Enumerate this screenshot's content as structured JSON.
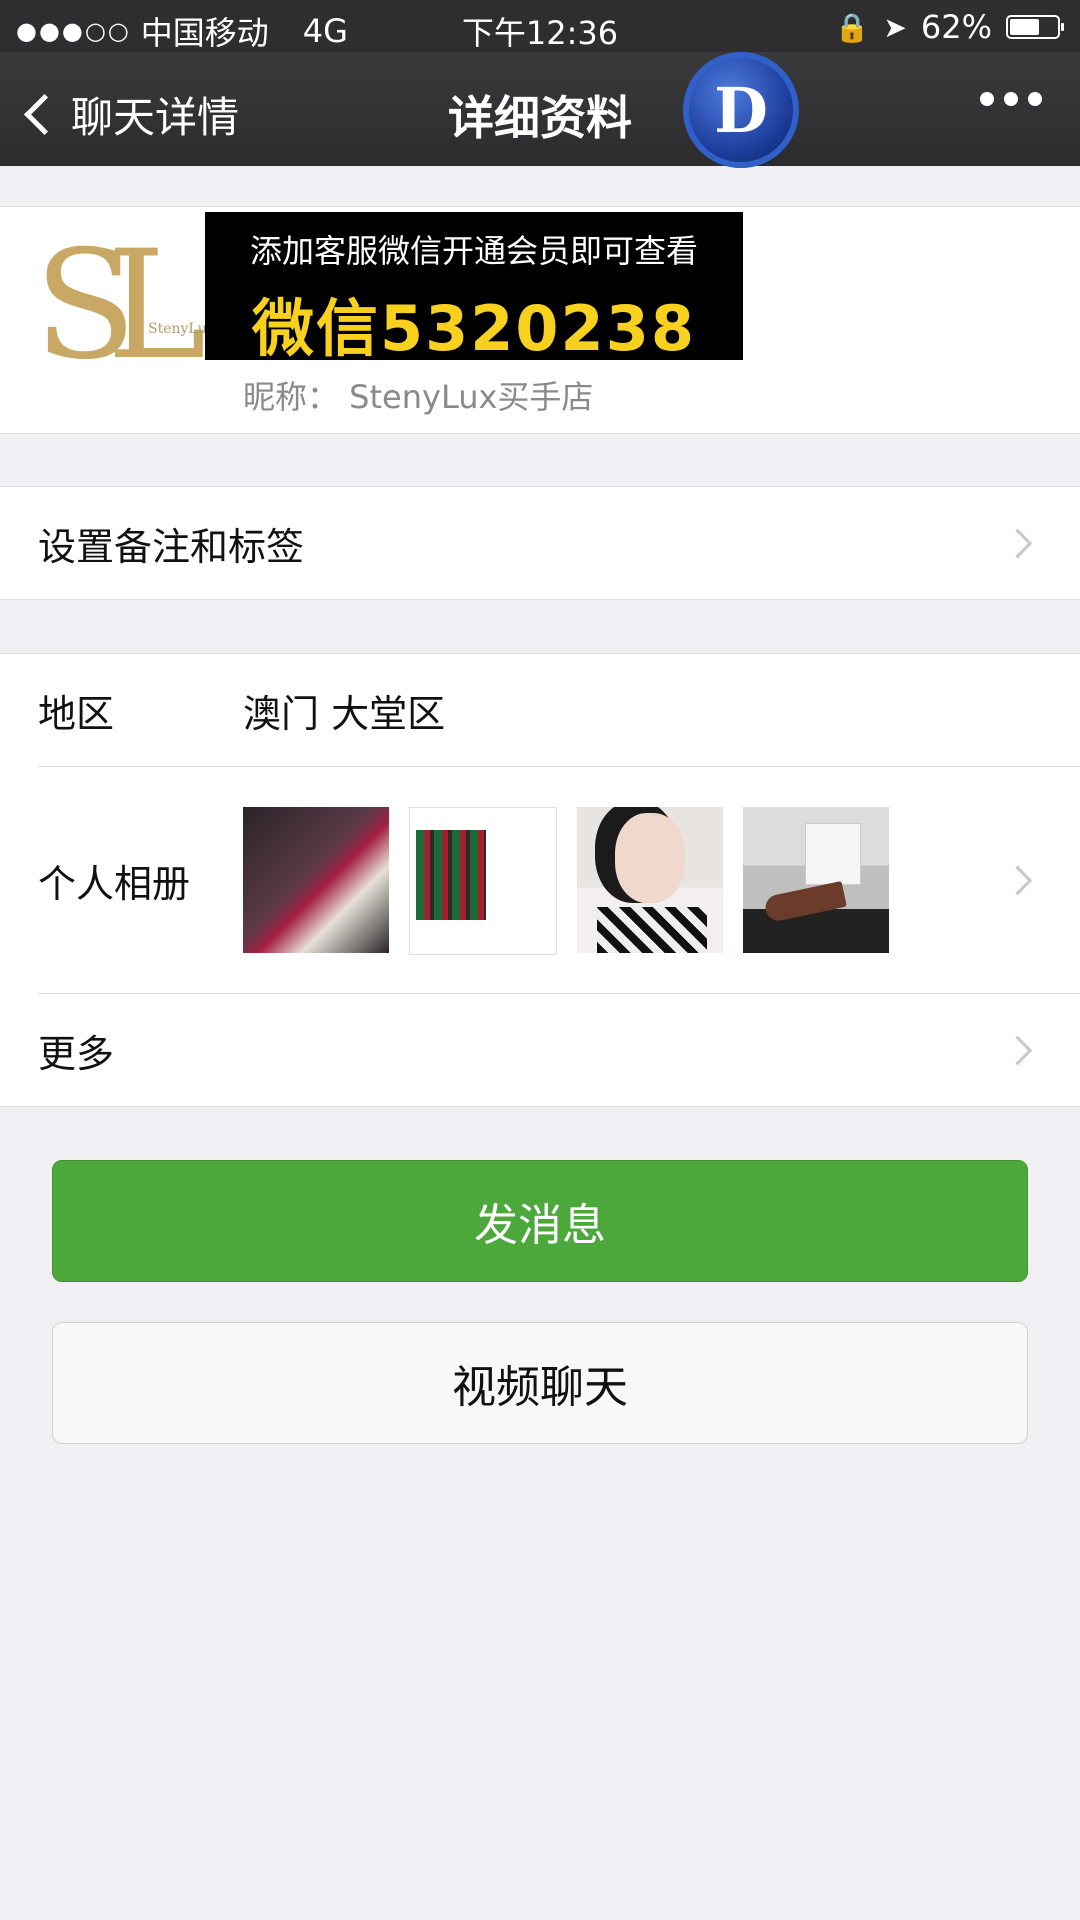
{
  "status_bar": {
    "signal_dots": "●●●○○",
    "carrier": "中国移动",
    "network": "4G",
    "time": "下午12:36",
    "battery_percent": "62%",
    "battery_level": 0.62
  },
  "navbar": {
    "back_label": "聊天详情",
    "title": "详细资料",
    "badge_letter": "D"
  },
  "profile": {
    "avatar_text": "SL",
    "avatar_subtext": "StenyLux",
    "promo_line1": "添加客服微信开通会员即可查看",
    "promo_line2": "微信5320238",
    "nickname": "昵称： StenyLux买手店"
  },
  "settings": {
    "remark_label": "设置备注和标签"
  },
  "info": {
    "region_label": "地区",
    "region_value": "澳门 大堂区",
    "album_label": "个人相册",
    "more_label": "更多"
  },
  "actions": {
    "send_message": "发消息",
    "video_chat": "视频聊天"
  },
  "colors": {
    "primary_green": "#4ca83a",
    "navbar_bg": "#2c2c2e",
    "promo_yellow": "#f7d11e"
  }
}
